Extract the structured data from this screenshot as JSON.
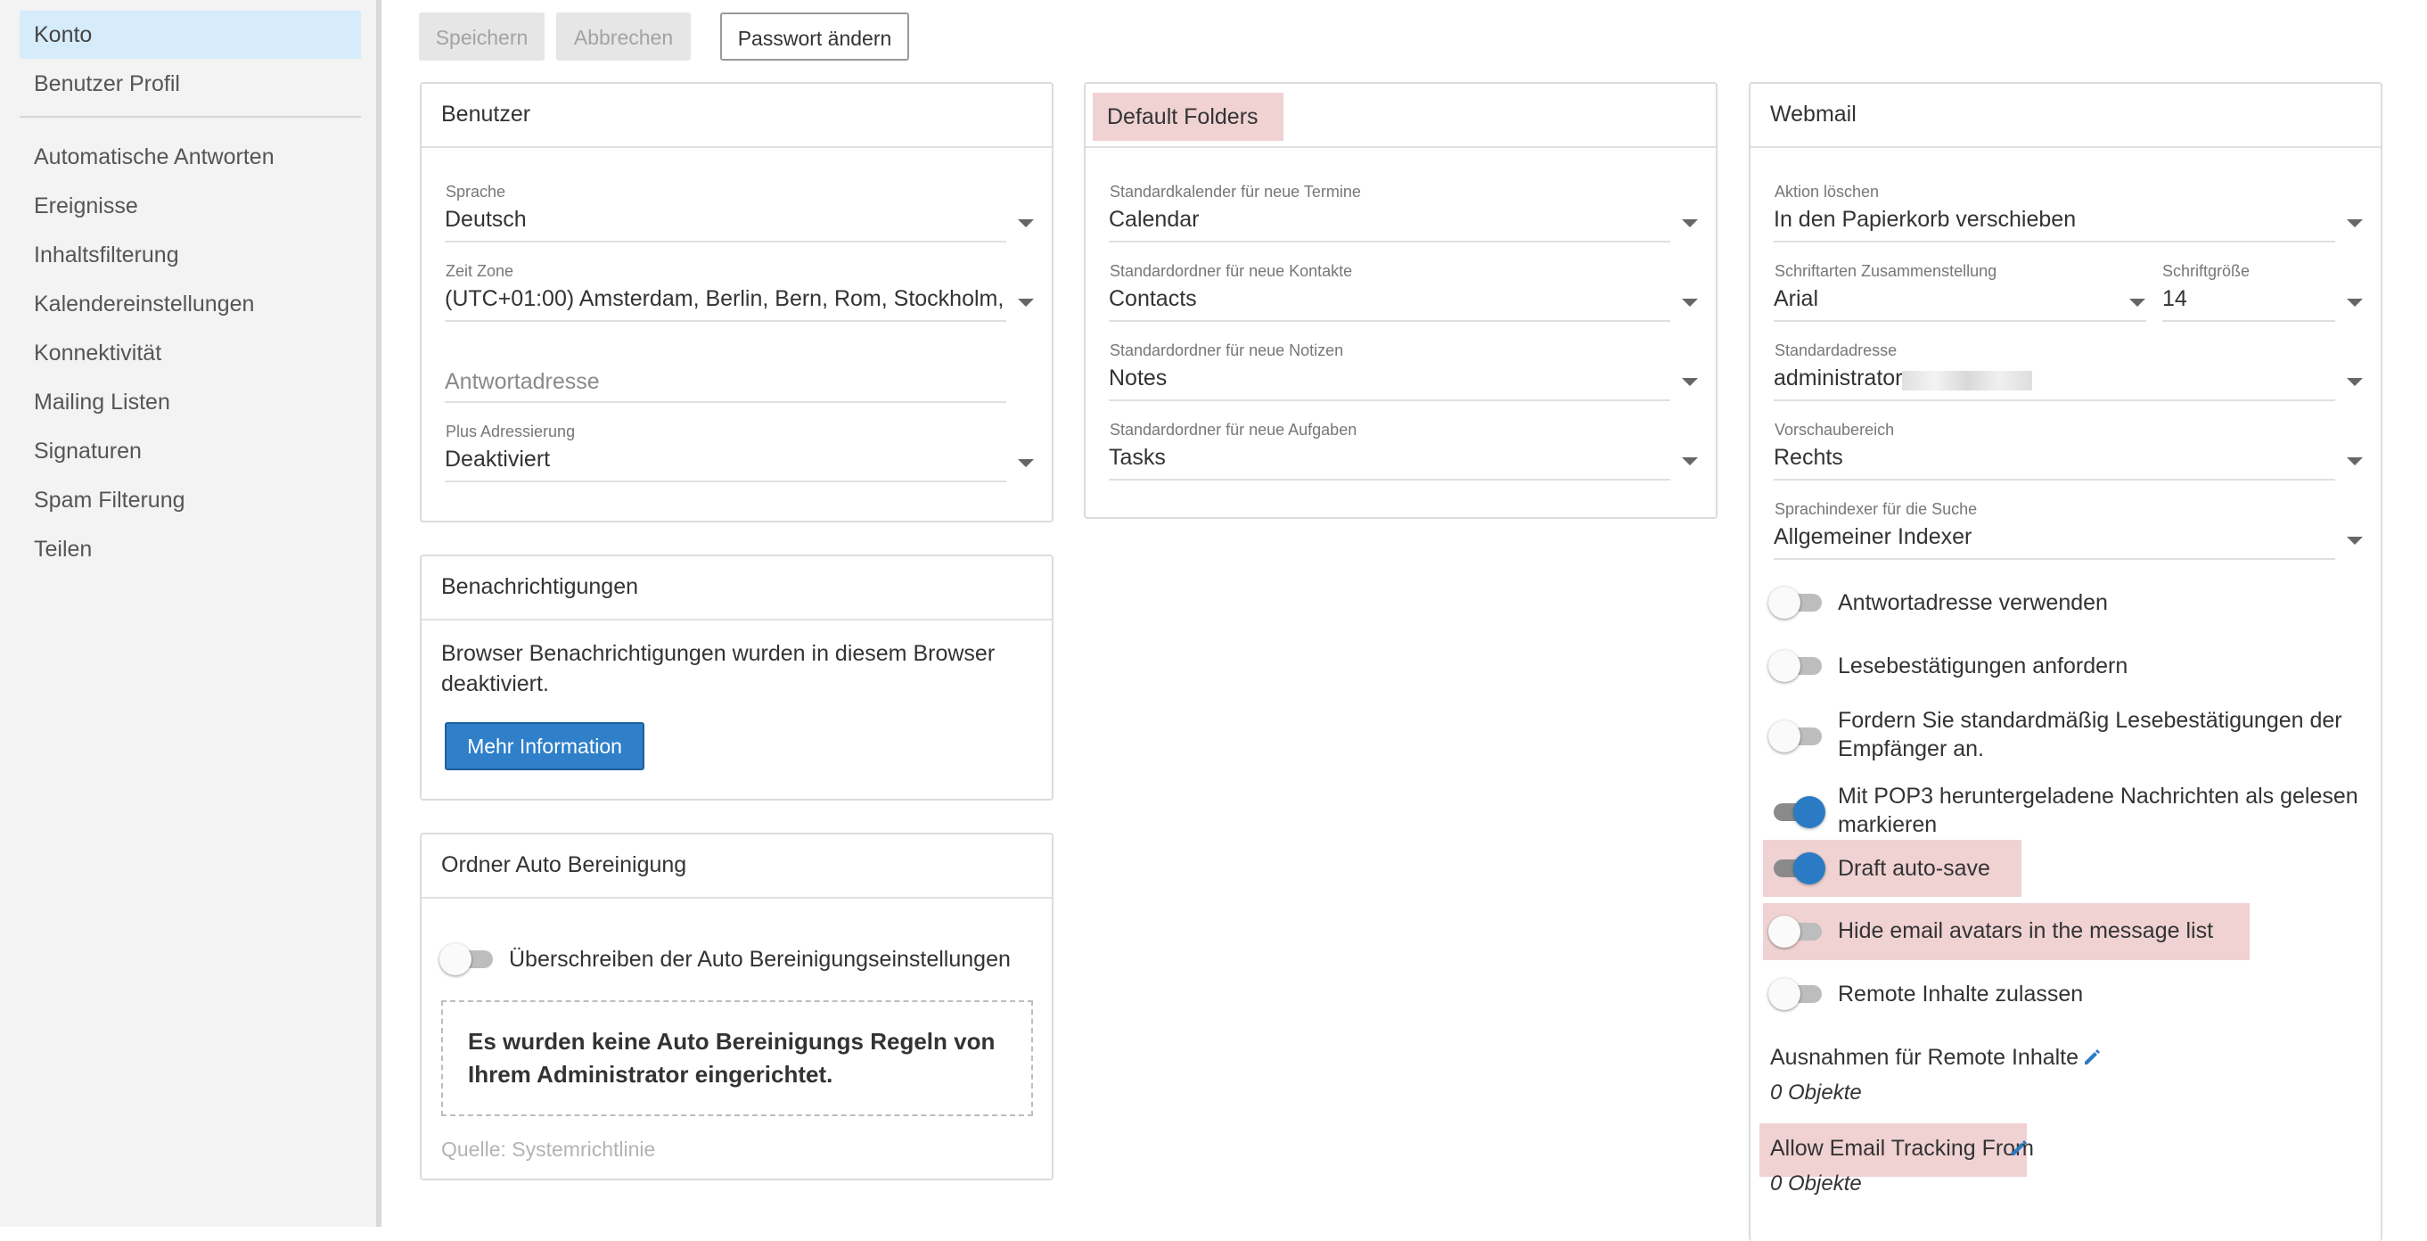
{
  "sidebar": {
    "items": [
      {
        "label": "Konto"
      },
      {
        "label": "Benutzer Profil"
      },
      {
        "label": "Automatische Antworten"
      },
      {
        "label": "Ereignisse"
      },
      {
        "label": "Inhaltsfilterung"
      },
      {
        "label": "Kalendereinstellungen"
      },
      {
        "label": "Konnektivität"
      },
      {
        "label": "Mailing Listen"
      },
      {
        "label": "Signaturen"
      },
      {
        "label": "Spam Filterung"
      },
      {
        "label": "Teilen"
      }
    ]
  },
  "toolbar": {
    "save_label": "Speichern",
    "cancel_label": "Abbrechen",
    "password_label": "Passwort ändern"
  },
  "benutzer": {
    "title": "Benutzer",
    "language_label": "Sprache",
    "language_value": "Deutsch",
    "timezone_label": "Zeit Zone",
    "timezone_value": "(UTC+01:00) Amsterdam, Berlin, Bern, Rom, Stockholm,...",
    "reply_placeholder": "Antwortadresse",
    "plus_label": "Plus Adressierung",
    "plus_value": "Deaktiviert"
  },
  "notifications": {
    "title": "Benachrichtigungen",
    "text": "Browser Benachrichtigungen wurden in diesem Browser deaktiviert.",
    "button_label": "Mehr Information"
  },
  "autoclean": {
    "title": "Ordner Auto Bereinigung",
    "toggle_label": "Überschreiben der Auto Bereinigungseinstellungen",
    "info_text": "Es wurden keine Auto Bereinigungs Regeln von Ihrem Administrator eingerichtet.",
    "source_text": "Quelle: Systemrichtlinie"
  },
  "folders": {
    "title": "Default Folders",
    "calendar_label": "Standardkalender für neue Termine",
    "calendar_value": "Calendar",
    "contacts_label": "Standardordner für neue Kontakte",
    "contacts_value": "Contacts",
    "notes_label": "Standardordner für neue Notizen",
    "notes_value": "Notes",
    "tasks_label": "Standardordner für neue Aufgaben",
    "tasks_value": "Tasks"
  },
  "webmail": {
    "title": "Webmail",
    "delete_label": "Aktion löschen",
    "delete_value": "In den Papierkorb verschieben",
    "font_label": "Schriftarten Zusammenstellung",
    "font_value": "Arial",
    "size_label": "Schriftgröße",
    "size_value": "14",
    "address_label": "Standardadresse",
    "address_value": "administrator",
    "preview_label": "Vorschaubereich",
    "preview_value": "Rechts",
    "indexer_label": "Sprachindexer für die Suche",
    "indexer_value": "Allgemeiner Indexer",
    "toggles": [
      {
        "label": "Antwortadresse verwenden",
        "state": "off"
      },
      {
        "label": "Lesebestätigungen anfordern",
        "state": "off"
      },
      {
        "label": "Fordern Sie standardmäßig Lesebestätigungen der Empfänger an.",
        "state": "off"
      },
      {
        "label": "Mit POP3 heruntergeladene Nachrichten als gelesen markieren",
        "state": "on"
      },
      {
        "label": "Draft auto-save",
        "state": "on"
      },
      {
        "label": "Hide email avatars in the message list",
        "state": "off"
      },
      {
        "label": "Remote Inhalte zulassen",
        "state": "off"
      }
    ],
    "remote_exceptions_label": "Ausnahmen für Remote Inhalte",
    "remote_exceptions_count": "0 Objekte",
    "tracking_label": "Allow Email Tracking From",
    "tracking_count": "0 Objekte"
  },
  "colors": {
    "accent": "#2a7bc3",
    "highlight": "#f0d2d3",
    "sidebar_active": "#d6ecfb"
  }
}
